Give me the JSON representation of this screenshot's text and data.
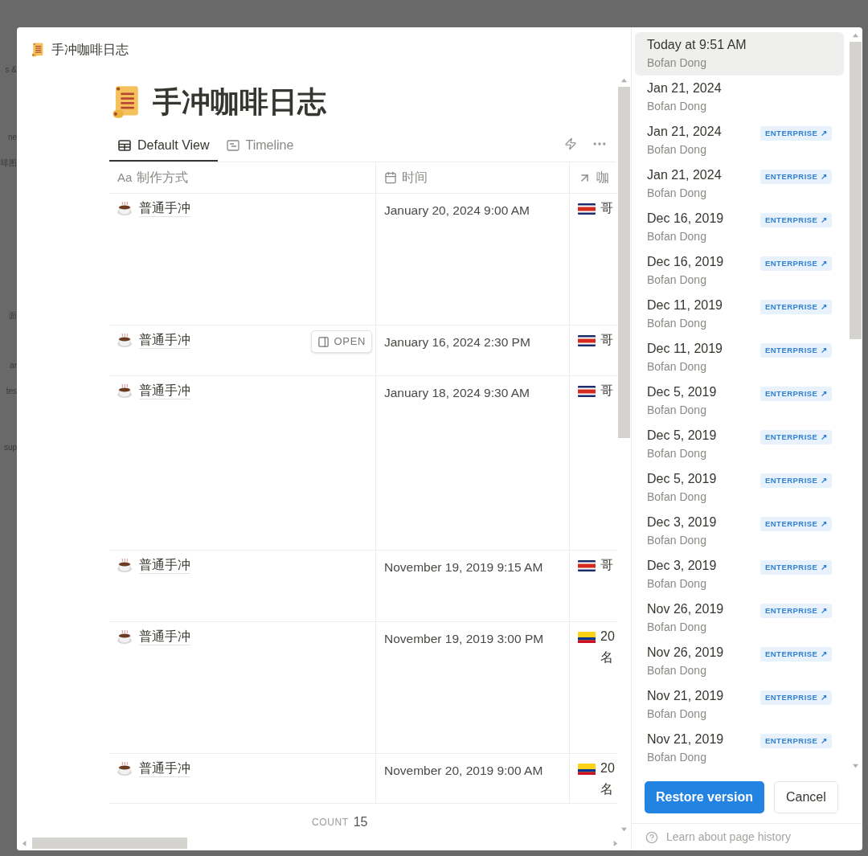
{
  "background_fragments": [
    "s &",
    "ne",
    "啡图",
    "面",
    "ar",
    "tes",
    "sup"
  ],
  "page": {
    "breadcrumb": "手冲咖啡日志",
    "title": "手冲咖啡日志",
    "views": [
      {
        "label": "Default View",
        "selected": true,
        "kind": "table"
      },
      {
        "label": "Timeline",
        "selected": false,
        "kind": "timeline"
      }
    ],
    "table": {
      "columns": [
        {
          "prefix": "Aa",
          "label": "制作方式",
          "kind": "title"
        },
        {
          "label": "时间",
          "kind": "date"
        },
        {
          "label": "咖",
          "kind": "relation"
        }
      ],
      "rows": [
        {
          "name": "普通手冲",
          "time": "January 20, 2024 9:00 AM",
          "bean": {
            "kind": "red-band",
            "lines": [
              "哥"
            ]
          }
        },
        {
          "name": "普通手冲",
          "open_button": "OPEN",
          "time": "January 16, 2024 2:30 PM",
          "bean": {
            "kind": "red-band",
            "lines": [
              "哥"
            ]
          }
        },
        {
          "name": "普通手冲",
          "time": "January 18, 2024 9:30 AM",
          "bean": {
            "kind": "red-band",
            "lines": [
              "哥"
            ]
          }
        },
        {
          "name": "普通手冲",
          "time": "November 19, 2019 9:15 AM",
          "bean": {
            "kind": "red-band",
            "lines": [
              "哥"
            ]
          }
        },
        {
          "name": "普通手冲",
          "time": "November 19, 2019 3:00 PM",
          "bean": {
            "kind": "yellow-band",
            "lines": [
              "20",
              "名"
            ]
          }
        },
        {
          "name": "普通手冲",
          "time": "November 20, 2019 9:00 AM",
          "bean": {
            "kind": "yellow-band",
            "lines": [
              "20",
              "名"
            ]
          }
        }
      ],
      "count_label": "COUNT",
      "count": "15"
    }
  },
  "history": {
    "versions": [
      {
        "date": "Today at 9:51 AM",
        "author": "Bofan Dong",
        "selected": true
      },
      {
        "date": "Jan 21, 2024",
        "author": "Bofan Dong",
        "selected": false
      },
      {
        "date": "Jan 21, 2024",
        "author": "Bofan Dong",
        "selected": false,
        "badge": "ENTERPRISE ↗"
      },
      {
        "date": "Jan 21, 2024",
        "author": "Bofan Dong",
        "selected": false,
        "badge": "ENTERPRISE ↗"
      },
      {
        "date": "Dec 16, 2019",
        "author": "Bofan Dong",
        "selected": false,
        "badge": "ENTERPRISE ↗"
      },
      {
        "date": "Dec 16, 2019",
        "author": "Bofan Dong",
        "selected": false,
        "badge": "ENTERPRISE ↗"
      },
      {
        "date": "Dec 11, 2019",
        "author": "Bofan Dong",
        "selected": false,
        "badge": "ENTERPRISE ↗"
      },
      {
        "date": "Dec 11, 2019",
        "author": "Bofan Dong",
        "selected": false,
        "badge": "ENTERPRISE ↗"
      },
      {
        "date": "Dec 5, 2019",
        "author": "Bofan Dong",
        "selected": false,
        "badge": "ENTERPRISE ↗"
      },
      {
        "date": "Dec 5, 2019",
        "author": "Bofan Dong",
        "selected": false,
        "badge": "ENTERPRISE ↗"
      },
      {
        "date": "Dec 5, 2019",
        "author": "Bofan Dong",
        "selected": false,
        "badge": "ENTERPRISE ↗"
      },
      {
        "date": "Dec 3, 2019",
        "author": "Bofan Dong",
        "selected": false,
        "badge": "ENTERPRISE ↗"
      },
      {
        "date": "Dec 3, 2019",
        "author": "Bofan Dong",
        "selected": false,
        "badge": "ENTERPRISE ↗"
      },
      {
        "date": "Nov 26, 2019",
        "author": "Bofan Dong",
        "selected": false,
        "badge": "ENTERPRISE ↗"
      },
      {
        "date": "Nov 26, 2019",
        "author": "Bofan Dong",
        "selected": false,
        "badge": "ENTERPRISE ↗"
      },
      {
        "date": "Nov 21, 2019",
        "author": "Bofan Dong",
        "selected": false,
        "badge": "ENTERPRISE ↗"
      },
      {
        "date": "Nov 21, 2019",
        "author": "Bofan Dong",
        "selected": false,
        "badge": "ENTERPRISE ↗"
      }
    ],
    "restore_button": "Restore version",
    "cancel_button": "Cancel",
    "help_link": "Learn about page history"
  }
}
